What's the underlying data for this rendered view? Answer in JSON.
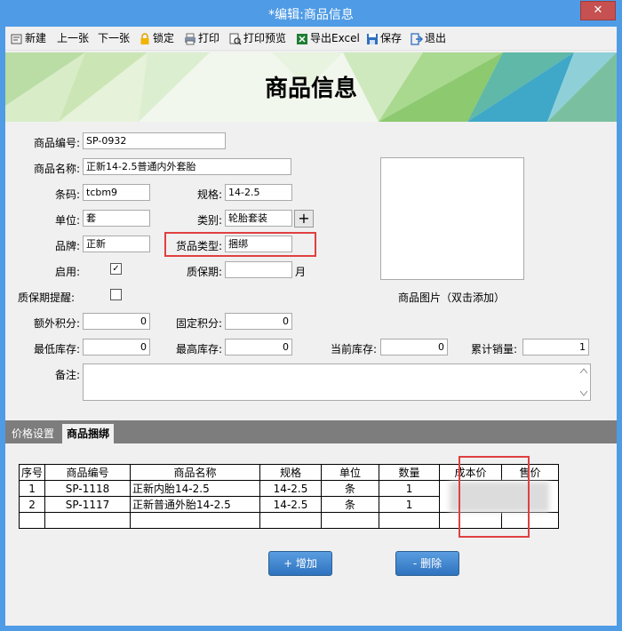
{
  "window": {
    "title": "*编辑:商品信息",
    "close_symbol": "✕"
  },
  "toolbar": {
    "new": "新建",
    "prev": "上一张",
    "next": "下一张",
    "lock": "锁定",
    "print": "打印",
    "print_preview": "打印预览",
    "export_excel": "导出Excel",
    "save": "保存",
    "exit": "退出"
  },
  "banner": {
    "title": "商品信息"
  },
  "form": {
    "code_label": "商品编号:",
    "code_value": "SP-0932",
    "name_label": "商品名称:",
    "name_value": "正新14-2.5普通内外套胎",
    "barcode_label": "条码:",
    "barcode_value": "tcbm9",
    "spec_label": "规格:",
    "spec_value": "14-2.5",
    "unit_label": "单位:",
    "unit_value": "套",
    "category_label": "类别:",
    "category_value": "轮胎套装",
    "add_symbol": "+",
    "brand_label": "品牌:",
    "brand_value": "正新",
    "goods_type_label": "货品类型:",
    "goods_type_value": "捆绑",
    "enabled_label": "启用:",
    "enabled_check": "✓",
    "shelf_life_label": "质保期:",
    "shelf_life_value": "",
    "shelf_life_unit": "月",
    "shelf_remind_label": "质保期提醒:",
    "image_caption": "商品图片（双击添加）",
    "extra_points_label": "额外积分:",
    "extra_points_value": "0",
    "fixed_points_label": "固定积分:",
    "fixed_points_value": "0",
    "min_stock_label": "最低库存:",
    "min_stock_value": "0",
    "max_stock_label": "最高库存:",
    "max_stock_value": "0",
    "current_stock_label": "当前库存:",
    "current_stock_value": "0",
    "total_sales_label": "累计销量:",
    "total_sales_value": "1",
    "remark_label": "备注:"
  },
  "tabs": [
    "价格设置",
    "商品捆绑"
  ],
  "table": {
    "headers": [
      "序号",
      "商品编号",
      "商品名称",
      "规格",
      "单位",
      "数量",
      "成本价",
      "售价"
    ],
    "rows": [
      [
        "1",
        "SP-1118",
        "正新内胎14-2.5",
        "14-2.5",
        "条",
        "1"
      ],
      [
        "2",
        "SP-1117",
        "正新普通外胎14-2.5",
        "14-2.5",
        "条",
        "1"
      ]
    ]
  },
  "buttons": {
    "add": "+ 增加",
    "delete": "- 删除"
  },
  "colors": {
    "title_bar": "#4f9be6",
    "highlight": "#e04040",
    "button": "#3a7fcc"
  }
}
